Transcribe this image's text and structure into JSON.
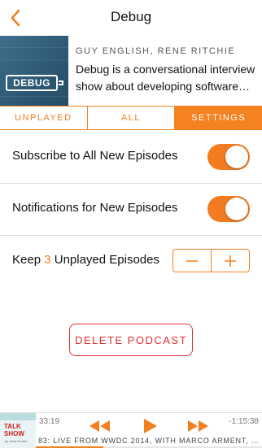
{
  "nav": {
    "title": "Debug",
    "back_icon": "chevron-left-icon"
  },
  "podcast": {
    "authors": "GUY ENGLISH, RENE RITCHIE",
    "description": "Debug is a conversational interview show about developing software…",
    "artwork_logo": "DEBUG"
  },
  "tabs": [
    {
      "label": "UNPLAYED",
      "active": false
    },
    {
      "label": "ALL",
      "active": false
    },
    {
      "label": "SETTINGS",
      "active": true
    }
  ],
  "settings": {
    "subscribe_label": "Subscribe to All New Episodes",
    "subscribe_on": true,
    "notifications_label": "Notifications for New Episodes",
    "notifications_on": true,
    "keep_prefix": "Keep",
    "keep_count": "3",
    "keep_suffix": "Unplayed Episodes",
    "decrement_icon": "minus-icon",
    "increment_icon": "plus-icon"
  },
  "delete_button": "DELETE PODCAST",
  "player": {
    "elapsed": "33:19",
    "remaining": "-1:15:38",
    "episode_title": "83: LIVE FROM WWDC 2014, WITH MARCO ARMENT, CA…",
    "progress": 0.3,
    "art_title": "TALK SHOW",
    "art_byline": "by John Gruber"
  },
  "colors": {
    "accent": "#f08020",
    "destructive": "#e03030"
  }
}
